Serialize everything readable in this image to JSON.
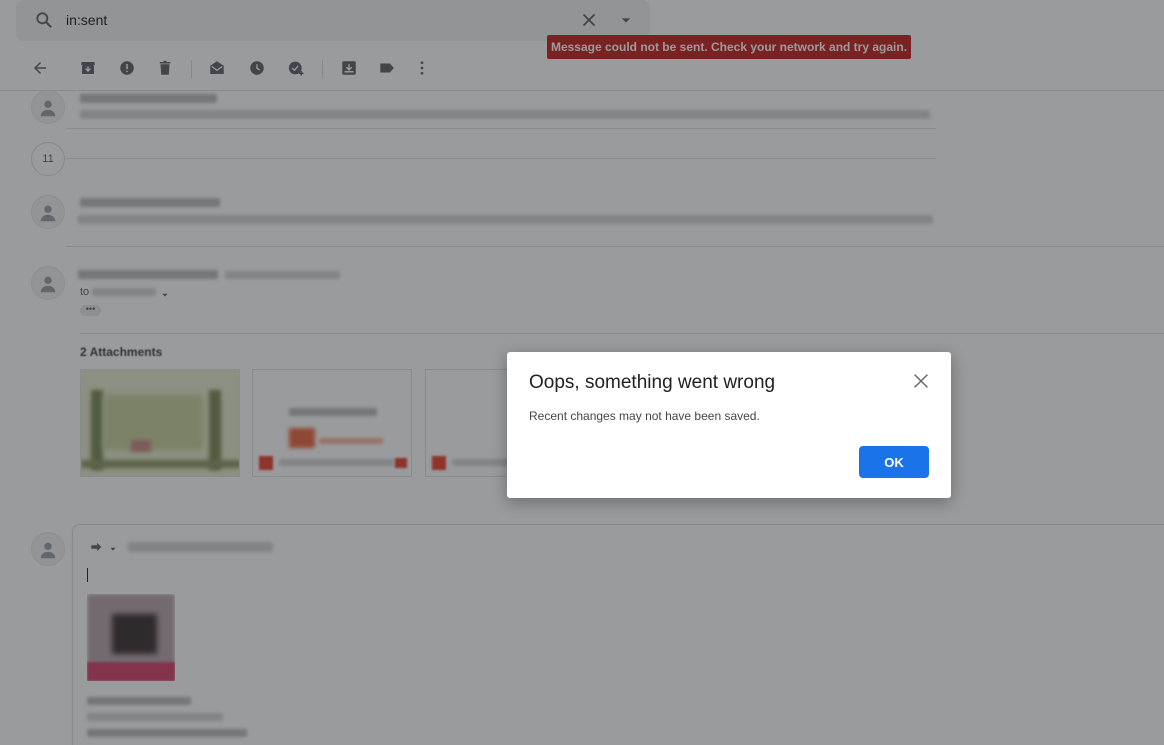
{
  "search": {
    "value": "in:sent"
  },
  "toast": {
    "message": "Message could not be sent. Check your network and try again."
  },
  "toolbar": {
    "icons": [
      "back-arrow-icon",
      "archive-icon",
      "report-spam-icon",
      "delete-icon",
      "mark-unread-icon",
      "snooze-icon",
      "add-to-tasks-icon",
      "move-to-icon",
      "labels-icon",
      "more-vert-icon"
    ]
  },
  "thread": {
    "collapsed_count": "11",
    "to_prefix": "to",
    "ellipsis": "•••",
    "attachments_label": "2 Attachments"
  },
  "dialog": {
    "title": "Oops, something went wrong",
    "message": "Recent changes may not have been saved.",
    "ok_label": "OK"
  },
  "colors": {
    "toast_bg": "#c5221f",
    "primary_button": "#1a73e8",
    "overlay": "rgba(32,33,36,0.45)"
  }
}
